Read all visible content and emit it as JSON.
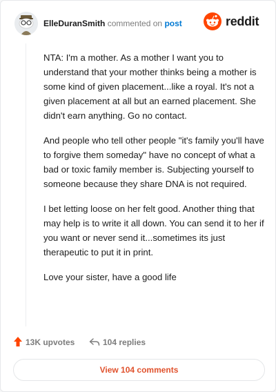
{
  "comment": {
    "username": "ElleDuranSmith",
    "commented_on": "commented on",
    "post_link": "post",
    "paragraphs": [
      "NTA: I'm a mother. As a mother I want you to understand that your mother thinks being a mother is some kind of given placement...like a royal. It's not a given placement at all but an earned placement. She didn't earn anything. Go no contact.",
      "And people who tell other people \"it's family you'll have to forgive them someday\" have no concept of what a bad or toxic family member is. Subjecting yourself to someone because they share DNA is not required.",
      "I bet letting loose on her felt good. Another thing that may help is to write it all down. You can send it to her if you want or never send it...sometimes its just therapeutic to put it in print.",
      "Love your sister, have a good life"
    ]
  },
  "brand": {
    "name": "reddit",
    "color": "#ff4500"
  },
  "actions": {
    "upvotes": "13K upvotes",
    "replies": "104 replies"
  },
  "view_comments": "View 104 comments",
  "icons": {
    "avatar": "snoo-avatar-icon",
    "logo": "reddit-logo-icon",
    "upvote": "upvote-arrow-icon",
    "reply": "reply-arrow-icon"
  }
}
